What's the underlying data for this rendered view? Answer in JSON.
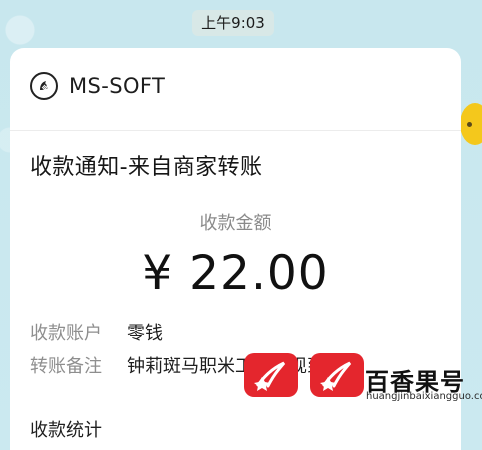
{
  "status_time": "上午9:03",
  "brand": {
    "name": "MS-SOFT",
    "logo_icon": "zebra-icon"
  },
  "notice": {
    "title": "收款通知-来自商家转账",
    "amount_label": "收款金额",
    "amount": "¥ 22.00",
    "account_label": "收款账户",
    "account_value": "零钱",
    "note_label": "转账备注",
    "note_value": "钟莉斑马职米工资提现到账",
    "stats_label": "收款统计"
  },
  "watermark": {
    "text": "百香果号",
    "url": "huangjinbaixiangguo.com"
  },
  "colors": {
    "background": "#c9e8ef",
    "card": "#ffffff",
    "stamp": "#e4262d"
  }
}
